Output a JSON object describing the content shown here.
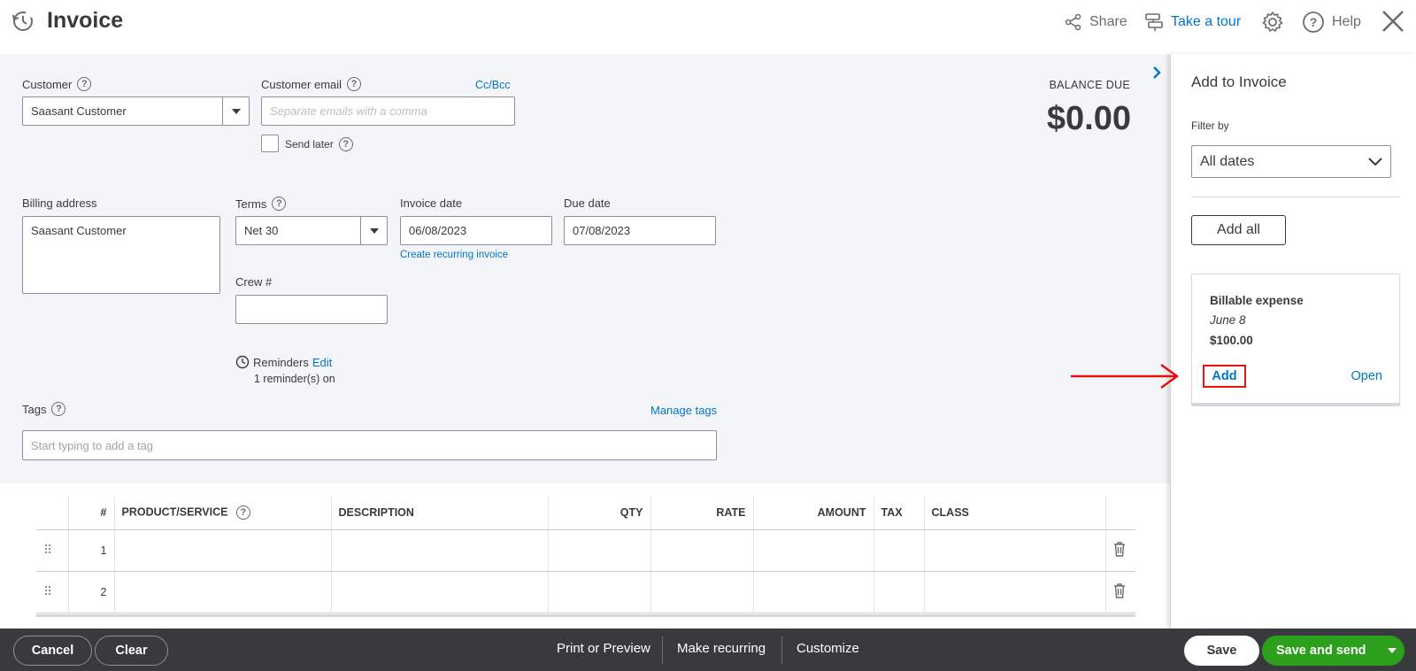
{
  "header": {
    "title": "Invoice",
    "share_label": "Share",
    "tour_label": "Take a tour",
    "help_label": "Help"
  },
  "customer": {
    "label": "Customer",
    "value": "Saasant Customer"
  },
  "customer_email": {
    "label": "Customer email",
    "placeholder": "Separate emails with a comma",
    "cc_bcc": "Cc/Bcc",
    "send_later": "Send later"
  },
  "balance": {
    "label": "BALANCE DUE",
    "amount": "$0.00"
  },
  "billing": {
    "label": "Billing address",
    "value": "Saasant Customer"
  },
  "terms": {
    "label": "Terms",
    "value": "Net 30"
  },
  "invoice_date": {
    "label": "Invoice date",
    "value": "06/08/2023",
    "recurring_link": "Create recurring invoice"
  },
  "due_date": {
    "label": "Due date",
    "value": "07/08/2023"
  },
  "crew": {
    "label": "Crew #",
    "value": ""
  },
  "reminders": {
    "label": "Reminders",
    "edit": "Edit",
    "status": "1 reminder(s) on"
  },
  "tags": {
    "label": "Tags",
    "manage": "Manage tags",
    "placeholder": "Start typing to add a tag"
  },
  "table": {
    "columns": [
      "#",
      "PRODUCT/SERVICE",
      "DESCRIPTION",
      "QTY",
      "RATE",
      "AMOUNT",
      "TAX",
      "CLASS"
    ],
    "rows": [
      {
        "num": "1"
      },
      {
        "num": "2"
      }
    ]
  },
  "panel": {
    "title": "Add to Invoice",
    "filter_label": "Filter by",
    "filter_value": "All dates",
    "add_all": "Add all",
    "card": {
      "title": "Billable expense",
      "date": "June 8",
      "amount": "$100.00",
      "add": "Add",
      "open": "Open"
    }
  },
  "footer": {
    "cancel": "Cancel",
    "clear": "Clear",
    "print": "Print or Preview",
    "recurring": "Make recurring",
    "customize": "Customize",
    "save": "Save",
    "save_send": "Save and send"
  },
  "colors": {
    "brand_green": "#2ca01c",
    "link_blue": "#0077c5",
    "footer_dark": "#393a3d",
    "annotation_red": "#e11111"
  }
}
